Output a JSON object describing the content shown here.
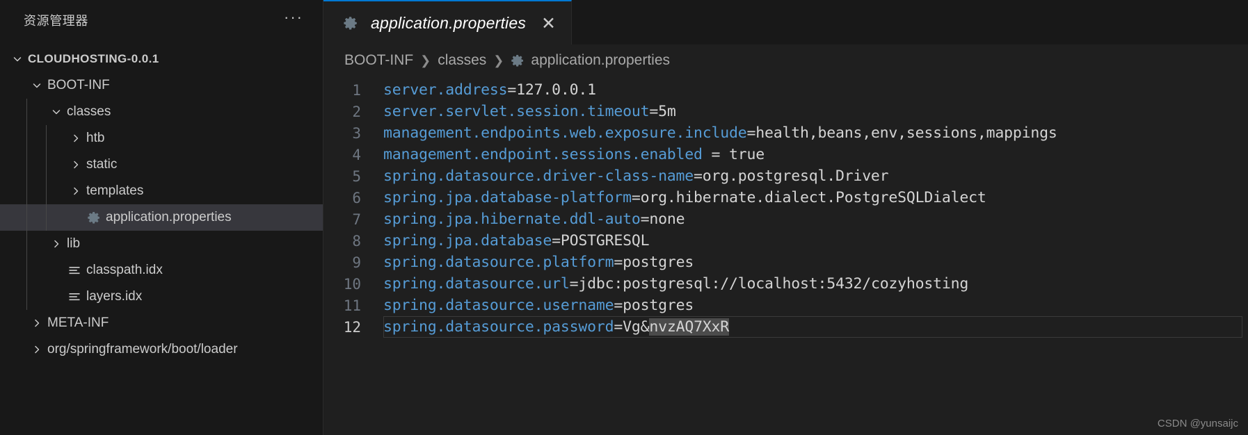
{
  "sidebar": {
    "title": "资源管理器",
    "more_actions": "···",
    "tree": [
      {
        "label": "CLOUDHOSTING-0.0.1",
        "depth": 0,
        "type": "root",
        "twisty": "chevron-down-icon",
        "icon": "none",
        "selected": false
      },
      {
        "label": "BOOT-INF",
        "depth": 1,
        "type": "folder",
        "twisty": "chevron-down-icon",
        "icon": "none",
        "selected": false
      },
      {
        "label": "classes",
        "depth": 2,
        "type": "folder",
        "twisty": "chevron-down-icon",
        "icon": "none",
        "selected": false
      },
      {
        "label": "htb",
        "depth": 3,
        "type": "folder",
        "twisty": "chevron-right-icon",
        "icon": "none",
        "selected": false
      },
      {
        "label": "static",
        "depth": 3,
        "type": "folder",
        "twisty": "chevron-right-icon",
        "icon": "none",
        "selected": false
      },
      {
        "label": "templates",
        "depth": 3,
        "type": "folder",
        "twisty": "chevron-right-icon",
        "icon": "none",
        "selected": false
      },
      {
        "label": "application.properties",
        "depth": 3,
        "type": "file",
        "twisty": "none",
        "icon": "gear-icon",
        "selected": true
      },
      {
        "label": "lib",
        "depth": 2,
        "type": "folder",
        "twisty": "chevron-right-icon",
        "icon": "none",
        "selected": false
      },
      {
        "label": "classpath.idx",
        "depth": 2,
        "type": "file",
        "twisty": "none",
        "icon": "lines-icon",
        "selected": false
      },
      {
        "label": "layers.idx",
        "depth": 2,
        "type": "file",
        "twisty": "none",
        "icon": "lines-icon",
        "selected": false
      },
      {
        "label": "META-INF",
        "depth": 1,
        "type": "folder",
        "twisty": "chevron-right-icon",
        "icon": "none",
        "selected": false
      },
      {
        "label": "org/springframework/boot/loader",
        "depth": 1,
        "type": "folder",
        "twisty": "chevron-right-icon",
        "icon": "none",
        "selected": false
      }
    ]
  },
  "tabbar": {
    "tabs": [
      {
        "label": "application.properties",
        "icon": "gear-icon",
        "close": "✕",
        "active": true,
        "italic": true
      }
    ]
  },
  "breadcrumb": {
    "items": [
      {
        "label": "BOOT-INF",
        "icon": "none"
      },
      {
        "label": "classes",
        "icon": "none"
      },
      {
        "label": "application.properties",
        "icon": "gear-icon"
      }
    ],
    "separator": "❯"
  },
  "editor": {
    "current_line": 12,
    "lines": [
      {
        "no": "1",
        "key": "server.address",
        "eq": "=",
        "value": "127.0.0.1"
      },
      {
        "no": "2",
        "key": "server.servlet.session.timeout",
        "eq": "=",
        "value": "5m"
      },
      {
        "no": "3",
        "key": "management.endpoints.web.exposure.include",
        "eq": "=",
        "value": "health,beans,env,sessions,mappings"
      },
      {
        "no": "4",
        "key": "management.endpoint.sessions.enabled",
        "eq": " = ",
        "value": "true"
      },
      {
        "no": "5",
        "key": "spring.datasource.driver-class-name",
        "eq": "=",
        "value": "org.postgresql.Driver"
      },
      {
        "no": "6",
        "key": "spring.jpa.database-platform",
        "eq": "=",
        "value": "org.hibernate.dialect.PostgreSQLDialect"
      },
      {
        "no": "7",
        "key": "spring.jpa.hibernate.ddl-auto",
        "eq": "=",
        "value": "none"
      },
      {
        "no": "8",
        "key": "spring.jpa.database",
        "eq": "=",
        "value": "POSTGRESQL"
      },
      {
        "no": "9",
        "key": "spring.datasource.platform",
        "eq": "=",
        "value": "postgres"
      },
      {
        "no": "10",
        "key": "spring.datasource.url",
        "eq": "=",
        "value": "jdbc:postgresql://localhost:5432/cozyhosting"
      },
      {
        "no": "11",
        "key": "spring.datasource.username",
        "eq": "=",
        "value": "postgres"
      },
      {
        "no": "12",
        "key": "spring.datasource.password",
        "eq": "=",
        "value": "Vg&",
        "selected_value": "nvzAQ7XxR"
      }
    ]
  },
  "watermark": "CSDN @yunsaijc",
  "colors": {
    "accent": "#0078d4",
    "key": "#569cd6",
    "value": "#d4d4d4",
    "selection": "#4b4b4b",
    "sidebar_bg": "#181818",
    "editor_bg": "#1f1f1f",
    "row_selected": "#37373d"
  }
}
